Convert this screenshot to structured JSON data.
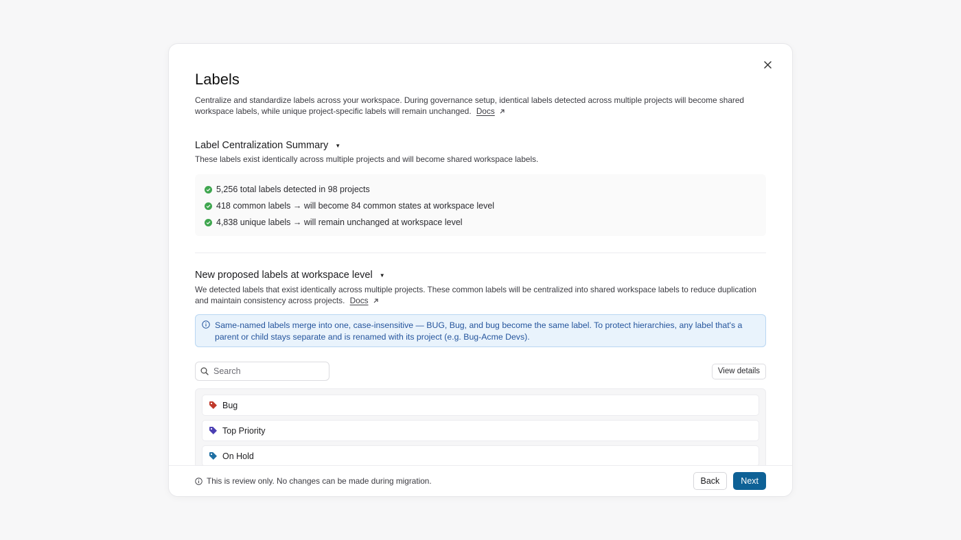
{
  "modal": {
    "title": "Labels",
    "description": "Centralize and standardize labels across your workspace. During governance setup, identical labels detected across multiple projects will become shared workspace labels, while unique project-specific labels will remain unchanged.",
    "docs_label": "Docs"
  },
  "summary": {
    "title": "Label Centralization Summary",
    "subtitle": "These labels exist identically across multiple projects and will become shared workspace labels.",
    "items": [
      "5,256 total labels detected in 98 projects",
      "418 common labels → will become 84 common states at workspace level",
      "4,838 unique labels → will remain unchanged at workspace level"
    ]
  },
  "proposed": {
    "title": "New proposed labels at workspace level",
    "description": "We detected labels that exist identically across multiple projects. These common labels will be centralized into shared workspace labels to reduce duplication and maintain consistency across projects.",
    "docs_label": "Docs",
    "banner": "Same-named labels merge into one, case-insensitive — BUG, Bug, and bug become the same label. To protect hierarchies, any label that's a parent or child stays separate and is renamed with its project (e.g. Bug-Acme Devs).",
    "search_placeholder": "Search",
    "view_details_label": "View details",
    "labels": [
      {
        "name": "Bug",
        "color": "#c0392b"
      },
      {
        "name": "Top Priority",
        "color": "#4b3fb3"
      },
      {
        "name": "On Hold",
        "color": "#1f6fa3"
      }
    ]
  },
  "footer": {
    "note": "This is review only. No changes can be made during migration.",
    "back_label": "Back",
    "next_label": "Next"
  },
  "colors": {
    "accent": "#0e6196",
    "success": "#3fa64f",
    "info_bg": "#e9f3fc",
    "info_text": "#24549c"
  }
}
